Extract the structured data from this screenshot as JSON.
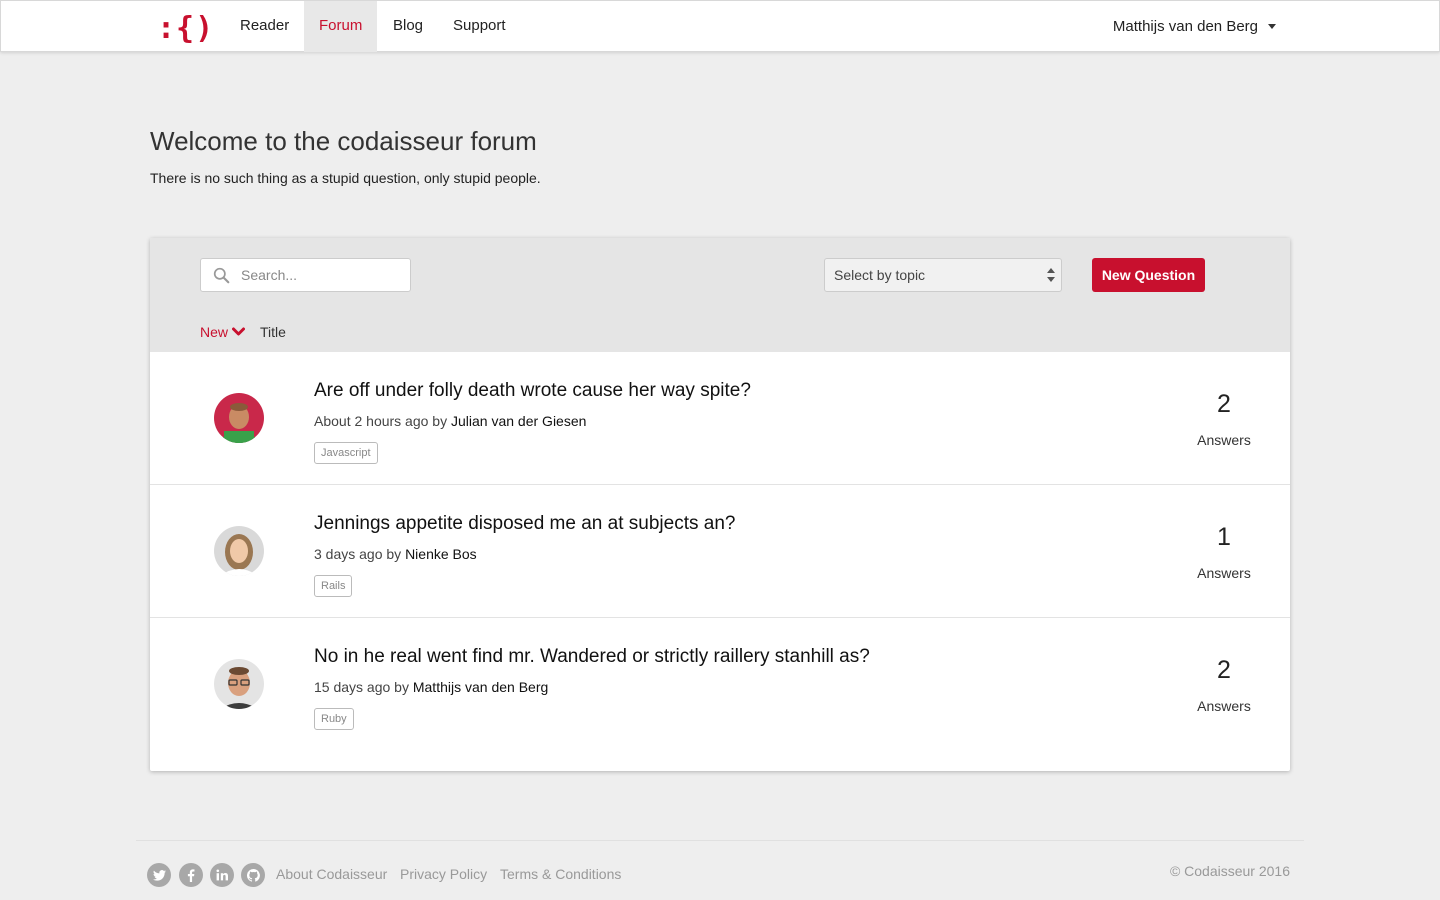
{
  "nav": {
    "logo_text": ":{)",
    "items": [
      {
        "label": "Reader"
      },
      {
        "label": "Forum",
        "active": true
      },
      {
        "label": "Blog"
      },
      {
        "label": "Support"
      }
    ],
    "user_name": "Matthijs van den Berg"
  },
  "hero": {
    "title": "Welcome to the codaisseur forum",
    "subtitle": "There is no such thing as a stupid question, only stupid people."
  },
  "toolbar": {
    "search_placeholder": "Search...",
    "topic_select": "Select by topic",
    "new_question": "New Question",
    "sort_new": "New",
    "sort_title": "Title"
  },
  "questions": [
    {
      "title": "Are off under folly death wrote cause her way spite?",
      "time": "About 2 hours ago by",
      "author": "Julian van der Giesen",
      "tag": "Javascript",
      "answers": "2",
      "answers_label": "Answers"
    },
    {
      "title": "Jennings appetite disposed me an at subjects an?",
      "time": "3 days ago by",
      "author": "Nienke Bos",
      "tag": "Rails",
      "answers": "1",
      "answers_label": "Answers"
    },
    {
      "title": "No in he real went find mr. Wandered or strictly raillery stanhill as?",
      "time": "15 days ago by",
      "author": "Matthijs van den Berg",
      "tag": "Ruby",
      "answers": "2",
      "answers_label": "Answers"
    }
  ],
  "footer": {
    "social": [
      "twitter-icon",
      "facebook-icon",
      "linkedin-icon",
      "github-icon"
    ],
    "links": [
      "About Codaisseur",
      "Privacy Policy",
      "Terms & Conditions"
    ],
    "copyright": "© Codaisseur 2016"
  },
  "colors": {
    "accent": "#c8102e",
    "background": "#eeeeee"
  }
}
